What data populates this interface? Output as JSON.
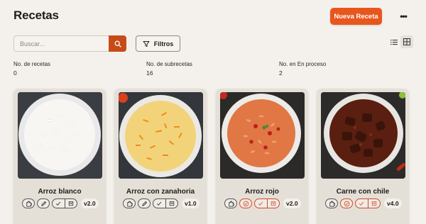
{
  "header": {
    "title": "Recetas",
    "new_button": "Nueva Receta",
    "more_icon": "more-horizontal-icon"
  },
  "toolbar": {
    "search_placeholder": "Buscar...",
    "search_value": "",
    "filter_label": "Filtros",
    "view_mode": "grid"
  },
  "stats": [
    {
      "label": "No. de recetas",
      "value": "0"
    },
    {
      "label": "No. de subrecetas",
      "value": "16"
    },
    {
      "label": "No. en En proceso",
      "value": "2"
    }
  ],
  "colors": {
    "accent": "#e8561d",
    "search_button": "#c74b17",
    "background": "#f4f1ec",
    "card": "#e5e0d7",
    "status_red": "#d24a2a"
  },
  "recipes": [
    {
      "name": "Arroz blanco",
      "version": "v2.0",
      "dish": "white-rice",
      "status": "edit"
    },
    {
      "name": "Arroz con zanahoria",
      "version": "v1.0",
      "dish": "carrot-rice",
      "status": "edit"
    },
    {
      "name": "Arroz rojo",
      "version": "v2.0",
      "dish": "red-rice",
      "status": "in-progress"
    },
    {
      "name": "Carne con chile",
      "version": "v4.0",
      "dish": "beef-chili",
      "status": "in-progress"
    }
  ]
}
